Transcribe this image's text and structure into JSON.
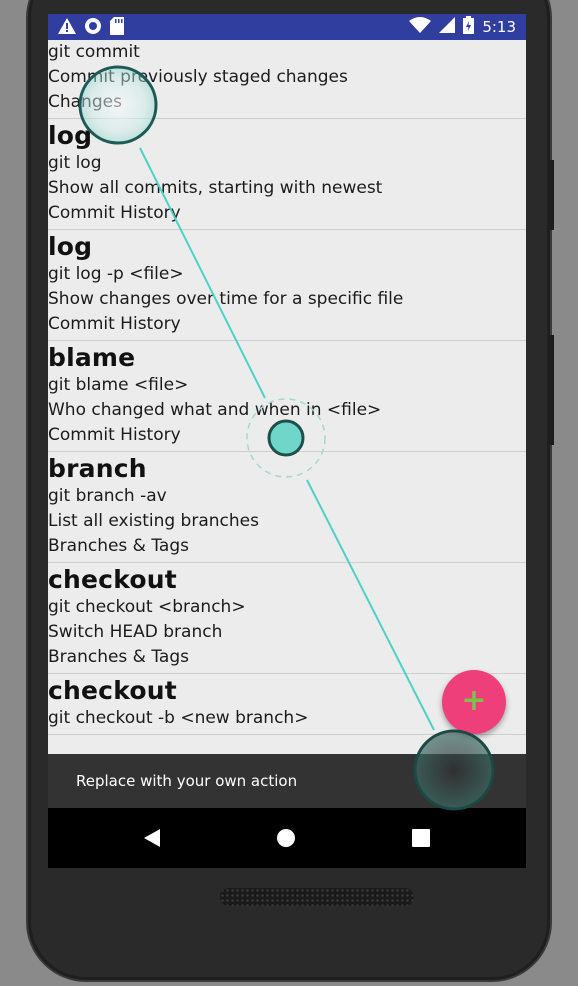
{
  "status_bar": {
    "icons_left": [
      "warning-icon",
      "circle-icon",
      "sd-card-icon"
    ],
    "icons_right": [
      "wifi-icon",
      "signal-icon",
      "battery-icon"
    ],
    "time": "5:13"
  },
  "list": {
    "first_partial": {
      "command": "git commit",
      "description": "Commit previously staged changes",
      "category": "Changes"
    },
    "items": [
      {
        "title": "log",
        "command": "git log",
        "description": "Show all commits, starting with newest",
        "category": "Commit History"
      },
      {
        "title": "log",
        "command": "git log -p <file>",
        "description": "Show changes over time for a specific file",
        "category": "Commit History"
      },
      {
        "title": "blame",
        "command": "git blame <file>",
        "description": "Who changed what and when in <file>",
        "category": "Commit History"
      },
      {
        "title": "branch",
        "command": "git branch -av",
        "description": "List all existing branches",
        "category": "Branches & Tags"
      },
      {
        "title": "checkout",
        "command": "git checkout <branch>",
        "description": "Switch HEAD branch",
        "category": "Branches & Tags"
      },
      {
        "title": "checkout",
        "command": "git checkout -b <new branch>",
        "description": "",
        "category": ""
      }
    ]
  },
  "snackbar": {
    "message": "Replace with your own action"
  },
  "fab": {
    "label": "+"
  },
  "nav": {
    "back": "back-icon",
    "home": "home-icon",
    "recents": "recents-icon"
  },
  "colors": {
    "status_bar": "#303f9f",
    "fab": "#ef3f7a",
    "fab_plus": "#7cc14a",
    "gesture": "#4fd1c5"
  }
}
